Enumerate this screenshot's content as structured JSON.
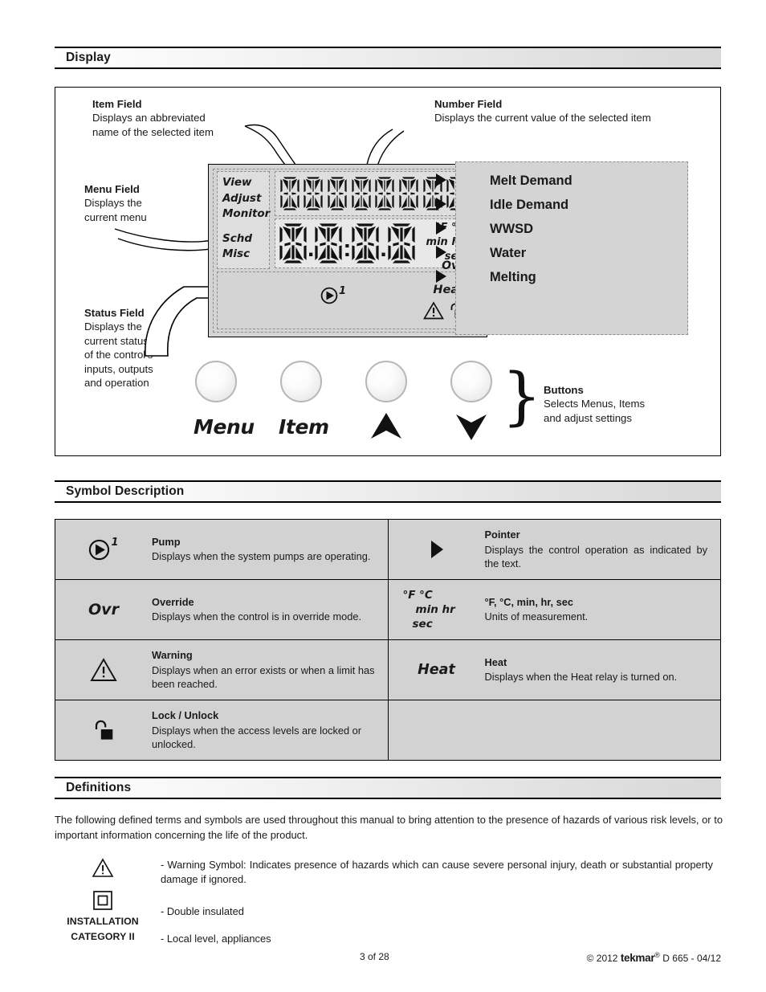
{
  "sections": {
    "display": "Display",
    "symbol_description": "Symbol Description",
    "definitions": "Definitions"
  },
  "display_panel": {
    "annotations": {
      "item_field": {
        "title": "Item Field",
        "line1": "Displays an abbreviated",
        "line2": "name of the selected item"
      },
      "number_field": {
        "title": "Number Field",
        "line1": "Displays the current value of the selected item"
      },
      "menu_field": {
        "title": "Menu Field",
        "line1": "Displays the",
        "line2": "current menu"
      },
      "status_field": {
        "title": "Status Field",
        "line1": "Displays the",
        "line2": "current status",
        "line3": "of the control's",
        "line4": "inputs, outputs",
        "line5": "and operation"
      },
      "buttons": {
        "title": "Buttons",
        "line1": "Selects Menus, Items",
        "line2": "and adjust settings"
      }
    },
    "lcd": {
      "menu_items": [
        "View",
        "Adjust",
        "Monitor"
      ],
      "menu_items_lower": [
        "Schd",
        "Misc"
      ],
      "item_field_chars": 8,
      "number_field_chars": 4,
      "units": [
        "°F °C",
        "min hr",
        "sec"
      ],
      "pump_label": "1",
      "override_label": "Ovr",
      "heat_label": "Heat"
    },
    "status_indicators": [
      "Melt Demand",
      "Idle Demand",
      "WWSD",
      "Water",
      "Melting"
    ],
    "buttons": [
      {
        "label": "Menu",
        "type": "text"
      },
      {
        "label": "Item",
        "type": "text"
      },
      {
        "label": "Up",
        "type": "arrow-up"
      },
      {
        "label": "Down",
        "type": "arrow-down"
      }
    ]
  },
  "symbol_table": {
    "rows": [
      {
        "left": {
          "icon": "pump-icon",
          "icon_sup": "1",
          "term": "Pump",
          "description": "Displays when the system pumps are operating."
        },
        "right": {
          "icon": "pointer-icon",
          "term": "Pointer",
          "description": "Displays the control operation as indicated by the text."
        }
      },
      {
        "left": {
          "icon": "ovr-text-icon",
          "icon_text": "Ovr",
          "term": "Override",
          "description": "Displays when the control is in override mode."
        },
        "right": {
          "icon": "units-icon",
          "icon_lines": [
            "°F °C",
            "min hr",
            "sec"
          ],
          "term": "°F, °C, min, hr, sec",
          "description": "Units of measurement."
        }
      },
      {
        "left": {
          "icon": "warning-triangle-icon",
          "term": "Warning",
          "description": "Displays when an error exists or when a limit has been reached."
        },
        "right": {
          "icon": "heat-text-icon",
          "icon_text": "Heat",
          "term": "Heat",
          "description": "Displays when the Heat relay is turned on."
        }
      },
      {
        "left": {
          "icon": "unlock-icon",
          "term": "Lock / Unlock",
          "term_bold_first": "Lock",
          "term_sep": " / ",
          "term_bold_second": "Unlock",
          "description": "Displays when the access levels are locked or unlocked."
        },
        "right": {
          "icon": "",
          "term": "",
          "description": ""
        }
      }
    ]
  },
  "definitions": {
    "intro": "The following defined terms and symbols are used throughout this manual to bring attention to the presence of hazards of various risk levels, or to important information concerning the life of the product.",
    "entries": [
      {
        "icon": "warning-triangle-icon",
        "text": "- Warning Symbol: Indicates presence of hazards which can cause severe personal injury, death or substantial property damage if ignored."
      },
      {
        "icon": "double-insulated-icon",
        "text": "- Double insulated"
      },
      {
        "icon": "installation-category-label",
        "label_line1": "INSTALLATION",
        "label_line2": "CATEGORY II",
        "text": "- Local level, appliances"
      }
    ]
  },
  "footer": {
    "page": "3 of 28",
    "copyright_prefix": "© 2012 ",
    "brand": "tekmar",
    "registered": "®",
    "doc": " D 665 - 04/12"
  },
  "colors": {
    "lcd_body": "#d4d4d4",
    "lcd_field": "#dedede",
    "table_cell": "#d2d2d2",
    "ink": "#1a1a1a"
  }
}
